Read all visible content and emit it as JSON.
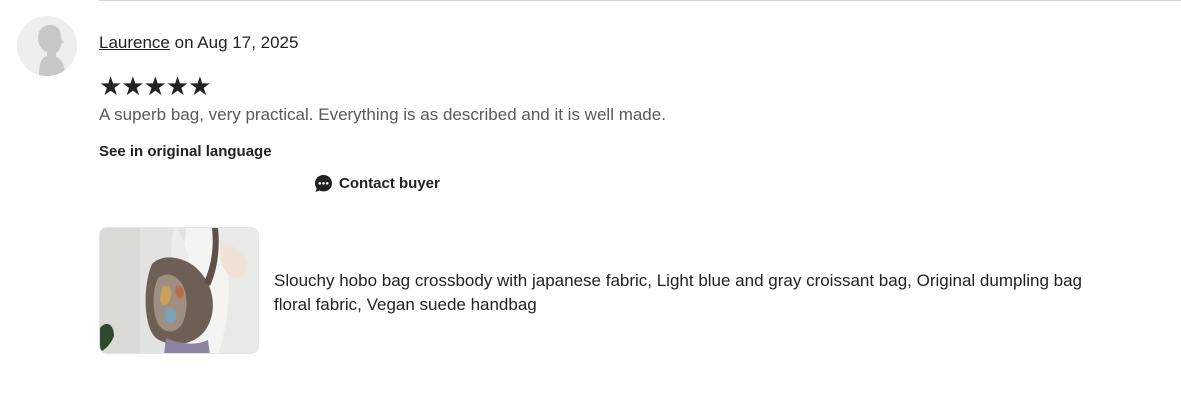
{
  "review": {
    "reviewer_name": "Laurence",
    "date_text": " on Aug 17, 2025",
    "rating": 5,
    "stars_text": "★★★★★",
    "text": "A superb bag, very practical. Everything is as described and it is well made.",
    "see_original_label": "See in original language",
    "contact_label": "Contact buyer"
  },
  "listing": {
    "title": "Slouchy hobo bag crossbody with japanese fabric, Light blue and gray croissant bag, Original dumpling bag floral fabric, Vegan suede handbag"
  },
  "icons": {
    "avatar": "default-user-avatar-icon",
    "contact": "chat-bubble-icon"
  },
  "colors": {
    "text": "#222222",
    "muted_text": "#595959",
    "divider": "#d6d6d6",
    "avatar_bg": "#eeeeee"
  }
}
